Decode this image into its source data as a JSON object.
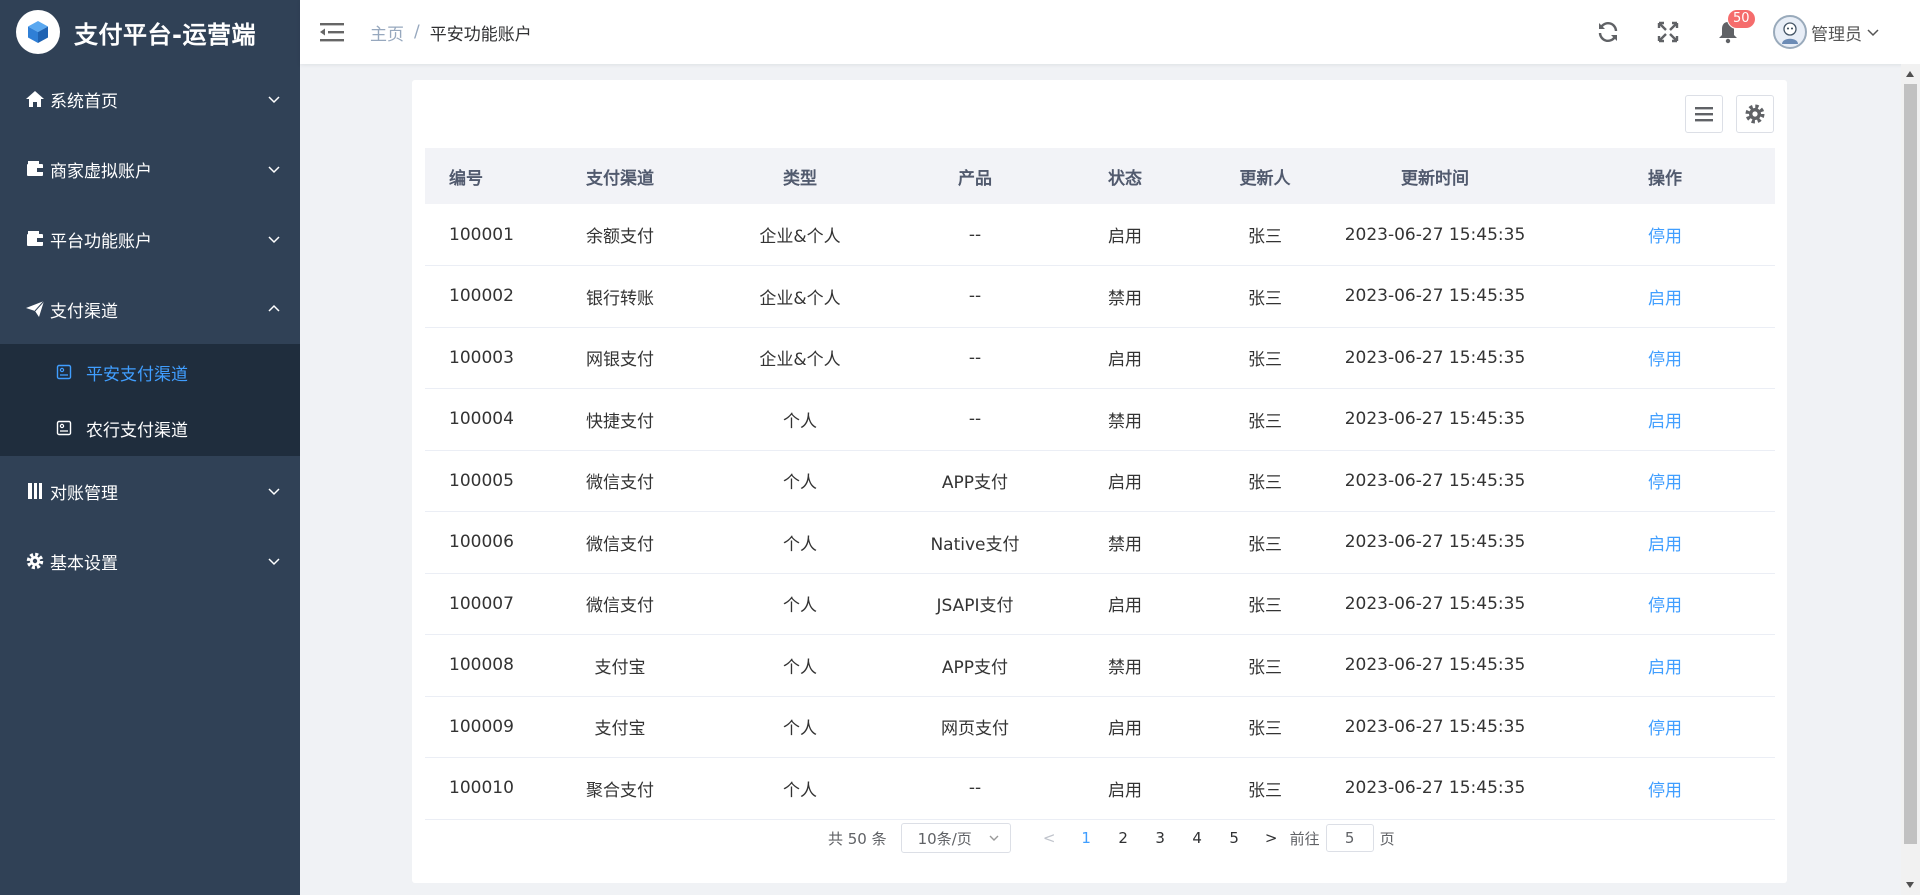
{
  "app": {
    "title": "支付平台-运营端"
  },
  "sidebar": {
    "items": [
      {
        "label": "系统首页",
        "icon": "home-icon"
      },
      {
        "label": "商家虚拟账户",
        "icon": "wallet-icon"
      },
      {
        "label": "平台功能账户",
        "icon": "wallet-icon"
      },
      {
        "label": "支付渠道",
        "icon": "send-icon",
        "expanded": true,
        "children": [
          {
            "label": "平安支付渠道",
            "active": true
          },
          {
            "label": "农行支付渠道",
            "active": false
          }
        ]
      },
      {
        "label": "对账管理",
        "icon": "book-icon"
      },
      {
        "label": "基本设置",
        "icon": "gear-icon"
      }
    ]
  },
  "header": {
    "breadcrumb": {
      "home": "主页",
      "separator": "/",
      "current": "平安功能账户"
    },
    "notification_count": "50",
    "user_name": "管理员"
  },
  "table": {
    "columns": [
      "编号",
      "支付渠道",
      "类型",
      "产品",
      "状态",
      "更新人",
      "更新时间",
      "操作"
    ],
    "rows": [
      {
        "id": "100001",
        "channel": "余额支付",
        "type": "企业&个人",
        "product": "--",
        "status": "启用",
        "updater": "张三",
        "time": "2023-06-27 15:45:35",
        "action": "停用"
      },
      {
        "id": "100002",
        "channel": "银行转账",
        "type": "企业&个人",
        "product": "--",
        "status": "禁用",
        "updater": "张三",
        "time": "2023-06-27 15:45:35",
        "action": "启用"
      },
      {
        "id": "100003",
        "channel": "网银支付",
        "type": "企业&个人",
        "product": "--",
        "status": "启用",
        "updater": "张三",
        "time": "2023-06-27 15:45:35",
        "action": "停用"
      },
      {
        "id": "100004",
        "channel": "快捷支付",
        "type": "个人",
        "product": "--",
        "status": "禁用",
        "updater": "张三",
        "time": "2023-06-27 15:45:35",
        "action": "启用"
      },
      {
        "id": "100005",
        "channel": "微信支付",
        "type": "个人",
        "product": "APP支付",
        "status": "启用",
        "updater": "张三",
        "time": "2023-06-27 15:45:35",
        "action": "停用"
      },
      {
        "id": "100006",
        "channel": "微信支付",
        "type": "个人",
        "product": "Native支付",
        "status": "禁用",
        "updater": "张三",
        "time": "2023-06-27 15:45:35",
        "action": "启用"
      },
      {
        "id": "100007",
        "channel": "微信支付",
        "type": "个人",
        "product": "JSAPI支付",
        "status": "启用",
        "updater": "张三",
        "time": "2023-06-27 15:45:35",
        "action": "停用"
      },
      {
        "id": "100008",
        "channel": "支付宝",
        "type": "个人",
        "product": "APP支付",
        "status": "禁用",
        "updater": "张三",
        "time": "2023-06-27 15:45:35",
        "action": "启用"
      },
      {
        "id": "100009",
        "channel": "支付宝",
        "type": "个人",
        "product": "网页支付",
        "status": "启用",
        "updater": "张三",
        "time": "2023-06-27 15:45:35",
        "action": "停用"
      },
      {
        "id": "100010",
        "channel": "聚合支付",
        "type": "个人",
        "product": "--",
        "status": "启用",
        "updater": "张三",
        "time": "2023-06-27 15:45:35",
        "action": "停用"
      }
    ]
  },
  "pagination": {
    "total": "共 50 条",
    "page_size": "10条/页",
    "prev": "<",
    "pages": [
      "1",
      "2",
      "3",
      "4",
      "5"
    ],
    "current_page": "1",
    "next": ">",
    "goto_label": "前往",
    "goto_value": "5",
    "page_suffix": "页"
  },
  "colors": {
    "sidebar_bg": "#304156",
    "submenu_bg": "#1f2d3d",
    "accent": "#409eff",
    "badge": "#f56c6c"
  }
}
